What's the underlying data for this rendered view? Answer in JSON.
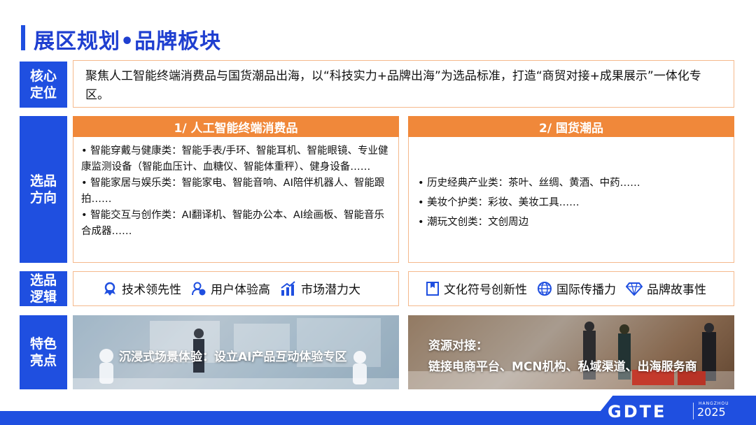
{
  "page": {
    "title": "展区规划•品牌板块"
  },
  "core": {
    "label": "核心\n定位",
    "text": "聚焦人工智能终端消费品与国货潮品出海，以“科技实力+品牌出海”为选品标准，打造“商贸对接+成果展示”一体化专区。"
  },
  "direction": {
    "label": "选品\n方向",
    "left": {
      "header": "1/ 人工智能终端消费品",
      "items": [
        "• 智能穿戴与健康类：智能手表/手环、智能耳机、智能眼镜、专业健康监测设备（智能血压计、血糖仪、智能体重秤）、健身设备……",
        "• 智能家居与娱乐类：智能家电、智能音响、AI陪伴机器人、智能跟拍……",
        "• 智能交互与创作类：AI翻译机、智能办公本、AI绘画板、智能音乐合成器……"
      ]
    },
    "right": {
      "header": "2/ 国货潮品",
      "items": [
        "• 历史经典产业类：茶叶、丝绸、黄酒、中药……",
        "• 美妆个护类：彩妆、美妆工具……",
        "• 潮玩文创类：文创周边"
      ]
    }
  },
  "logic": {
    "label": "选品\n逻辑",
    "left": [
      {
        "icon": "award-icon",
        "text": "技术领先性"
      },
      {
        "icon": "user-experience-icon",
        "text": "用户体验高"
      },
      {
        "icon": "growth-chart-icon",
        "text": "市场潜力大"
      }
    ],
    "right": [
      {
        "icon": "book-icon",
        "text": "文化符号创新性"
      },
      {
        "icon": "globe-icon",
        "text": "国际传播力"
      },
      {
        "icon": "diamond-icon",
        "text": "品牌故事性"
      }
    ]
  },
  "highlights": {
    "label": "特色\n亮点",
    "left_caption": "沉浸式场景体验：设立AI产品互动体验专区",
    "right_caption_line1": "资源对接：",
    "right_caption_line2": "链接电商平台、MCN机构、私域渠道、出海服务商"
  },
  "footer": {
    "logo": "GDTE",
    "city": "HANGZHOU",
    "year": "2025"
  },
  "colors": {
    "brand_blue": "#1f4fe0",
    "accent_orange": "#f0883a",
    "border_peach": "#f5b98c"
  }
}
